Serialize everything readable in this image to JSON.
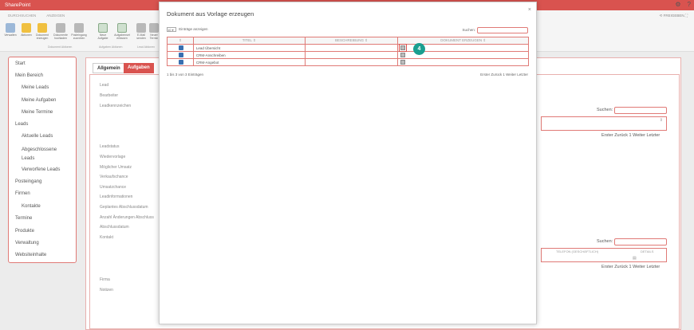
{
  "app": {
    "brand": "SharePoint",
    "top_icons": [
      "gear-icon",
      "help-icon"
    ]
  },
  "ribbon": {
    "tabs": [
      "DURCHSUCHEN",
      "ANZEIGEN"
    ],
    "buttons": [
      "Verwalten",
      "Aktionen",
      "Dokument erzeugen",
      "Dokumente hochladen",
      "Posteingang zuordnen",
      "Neue Aufgabe",
      "Aufgabenset erfassen",
      "E-Mail senden",
      "Neuer Termin"
    ],
    "groups": [
      "Dokument Aktionen",
      "Aufgaben Aktionen",
      "Lead Aktionen"
    ],
    "right_link": "FREIGEBEN"
  },
  "leftnav": {
    "items": [
      "Start",
      "Mein Bereich",
      "Meine Leads",
      "Meine Aufgaben",
      "Meine Termine",
      "Leads",
      "Aktuelle Leads",
      "Abgeschlossene Leads",
      "Verworfene Leads",
      "Posteingang",
      "Firmen",
      "Kontakte",
      "Termine",
      "Produkte",
      "Verwaltung",
      "Websiteinhalte"
    ]
  },
  "main": {
    "tabs": [
      "Allgemein",
      "Aufgaben"
    ],
    "fields": [
      "Lead",
      "Bearbeiter",
      "Leadkennzeichen",
      "Leadstatus",
      "Wiedervorlage",
      "Möglicher Umsatz",
      "Verkaufschance",
      "Umsatzchance",
      "Leadinformationen",
      "Geplantes Abschlussdatum",
      "Anzahl Änderungen Abschluss",
      "Abschlussdatum",
      "Kontakt",
      "Firma",
      "Notizen"
    ],
    "search_label": "Suchen:",
    "pager1": "Erster Zurück 1 Weiter Letzter",
    "col_phone": "TELEFON (GESCHÄFTLICH)",
    "col_details": "DETAILS",
    "pager2": "Erster Zurück 1 Weiter Letzter"
  },
  "modal": {
    "title": "Dokument aus Vorlage erzeugen",
    "close": "×",
    "entries_value": "10",
    "entries_label": "Einträge anzeigen",
    "search_label": "Suchen:",
    "columns": [
      "TITEL",
      "BESCHREIBUNG",
      "DOKUMENT ERZEUGEN"
    ],
    "rows": [
      {
        "title": "Lead Übersicht",
        "description": ""
      },
      {
        "title": "CRM-Anschreiben",
        "description": ""
      },
      {
        "title": "CRM-Angebot",
        "description": ""
      }
    ],
    "info": "1 bis 3 von 3 Einträgen",
    "pager": "Erster Zurück 1 Weiter Letzter",
    "badge": "4"
  },
  "colors": {
    "accent": "#d9534f",
    "badge": "#1a9e8f",
    "word": "#3a6fb0"
  }
}
